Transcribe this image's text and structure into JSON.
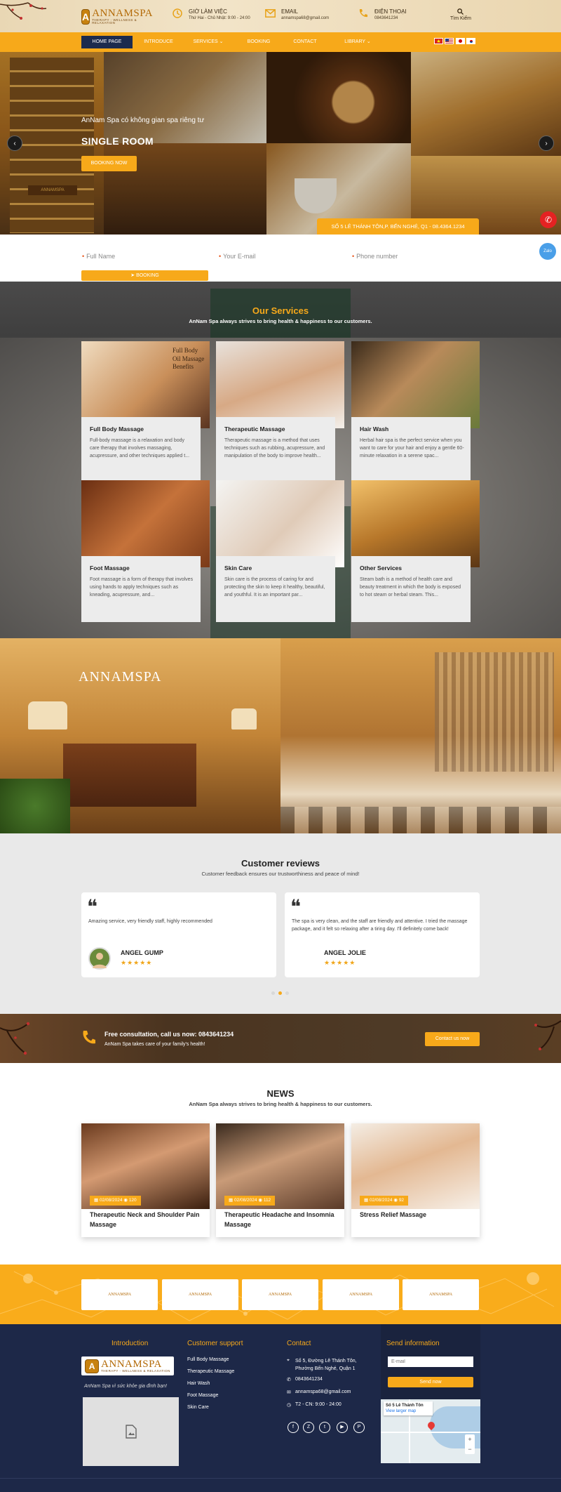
{
  "brand": {
    "name": "ANNAMSPA",
    "tagline": "THERAPY - WELLNESS & RELAXATION"
  },
  "header": {
    "hours_title": "GIỜ LÀM VIỆC",
    "hours_value": "Thứ Hai - Chủ Nhật: 9:00 - 24:00",
    "email_title": "EMAIL",
    "email_value": "annamspa68@gmail.com",
    "phone_title": "ĐIỆN THOẠI",
    "phone_value": "0843641234",
    "search_label": "Tìm Kiếm"
  },
  "nav": {
    "items": [
      "HOME PAGE",
      "INTRODUCE",
      "SERVICES",
      "BOOKING",
      "CONTACT",
      "LIBRARY"
    ],
    "flags": [
      "vietnam-flag",
      "usa-flag",
      "japan-flag",
      "korea-flag"
    ]
  },
  "hero": {
    "subtitle": "AnNam Spa có không gian spa riêng tư",
    "title": "SINGLE ROOM",
    "button": "BOOKING NOW",
    "address": "SỐ 5 LÊ THÁNH TÔN,P. BẾN NGHÉ, Q1 - 08.4364.1234",
    "zalo": "Zalo"
  },
  "booking": {
    "name_placeholder": "Full Name",
    "email_placeholder": "Your E-mail",
    "phone_placeholder": "Phone number",
    "button": "BOOKING"
  },
  "services": {
    "heading": "Our Services",
    "subheading": "AnNam Spa always strives to bring health & happiness to our customers.",
    "cards": [
      {
        "title": "Full Body Massage",
        "desc": "Full-body massage is a relaxation and body care therapy that involves massaging, acupressure, and other techniques applied t...",
        "overlay": "Full Body Oil Massage Benefits"
      },
      {
        "title": "Therapeutic Massage",
        "desc": "Therapeutic massage is a method that uses techniques such as rubbing, acupressure, and manipulation of the body to improve health..."
      },
      {
        "title": "Hair Wash",
        "desc": "Herbal hair spa is the perfect service when you want to care for your hair and enjoy a gentle 60-minute relaxation in a serene spac..."
      },
      {
        "title": "Foot Massage",
        "desc": "Foot massage is a form of therapy that involves using hands to apply techniques such as kneading, acupressure, and..."
      },
      {
        "title": "Skin Care",
        "desc": "Skin care is the process of caring for and protecting the skin to keep it healthy, beautiful, and youthful. It is an important par..."
      },
      {
        "title": "Other Services",
        "desc": "Steam bath is a method of health care and beauty treatment in which the body is exposed to hot steam or herbal steam. This..."
      }
    ]
  },
  "reviews": {
    "heading": "Customer reviews",
    "subheading": "Customer feedback ensures our trustworthiness and peace of mind!",
    "items": [
      {
        "text": "Amazing service, very friendly staff, highly recommended",
        "name": "ANGEL GUMP",
        "stars": "★★★★★"
      },
      {
        "text": "The spa is very clean, and the staff are friendly and attentive. I tried the massage package, and it felt so relaxing after a tiring day. I'll definitely come back!",
        "name": "ANGEL JOLIE",
        "stars": "★★★★★"
      }
    ]
  },
  "consult": {
    "title": "Free consultation, call us now:",
    "phone": "0843641234",
    "sub": "AnNam Spa takes care of your family's health!",
    "button": "Contact us now"
  },
  "news": {
    "heading": "NEWS",
    "subheading": "AnNam Spa always strives to bring health & happiness to our customers.",
    "items": [
      {
        "date": "02/08/2024",
        "views": "120",
        "title": "Therapeutic Neck and Shoulder Pain Massage"
      },
      {
        "date": "02/08/2024",
        "views": "112",
        "title": "Therapeutic Headache and Insomnia Massage"
      },
      {
        "date": "02/08/2024",
        "views": "92",
        "title": "Stress Relief Massage"
      }
    ]
  },
  "partners": {
    "label": "ANNAMSPA"
  },
  "footer": {
    "intro_title": "Introduction",
    "intro_text": "AnNam Spa vì sức khỏe gia đình bạn!",
    "support_title": "Customer support",
    "support_links": [
      "Full Body Massage",
      "Therapeutic Massage",
      "Hair Wash",
      "Foot Massage",
      "Skin Care"
    ],
    "contact_title": "Contact",
    "address": "Số 5, Đường Lê Thánh Tôn, Phường Bến Nghé, Quận 1",
    "phone": "0843641234",
    "email": "annamspa68@gmail.com",
    "hours": "T2 - CN: 9:00 - 24:00",
    "send_title": "Send information",
    "email_placeholder": "E-mail",
    "send_button": "Send now",
    "map_place": "Số 5 Lê Thánh Tôn",
    "map_link": "View larger map",
    "social": [
      "f",
      "t",
      "p",
      "y",
      "P"
    ]
  },
  "colors": {
    "accent": "#f7a91a",
    "navy": "#1d2848",
    "nav_active": "#1c2b4e"
  }
}
